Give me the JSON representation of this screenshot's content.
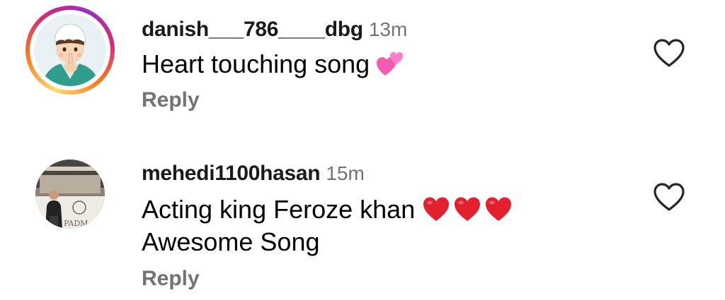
{
  "comments": [
    {
      "username": "danish___786____dbg",
      "time": "13m",
      "text_lines": [
        "Heart touching song"
      ],
      "emoji": [
        "two-hearts"
      ],
      "reply_label": "Reply",
      "has_story_ring": true,
      "avatar": "cartoon-boy-avatar"
    },
    {
      "username": "mehedi1100hasan",
      "time": "15m",
      "text_lines": [
        "Acting king Feroze khan",
        "Awesome Song"
      ],
      "emoji": [
        "red-heart",
        "red-heart",
        "red-heart"
      ],
      "reply_label": "Reply",
      "has_story_ring": false,
      "avatar": "photo-man-avatar",
      "avatar_sign_text": "PADM"
    }
  ],
  "icons": {
    "like": "heart-outline-icon"
  },
  "colors": {
    "secondary_text": "#737373",
    "heart_red": "#e0245e",
    "ring_gradient": [
      "#feda75",
      "#fa7e1e",
      "#d62976",
      "#962fbf"
    ]
  }
}
